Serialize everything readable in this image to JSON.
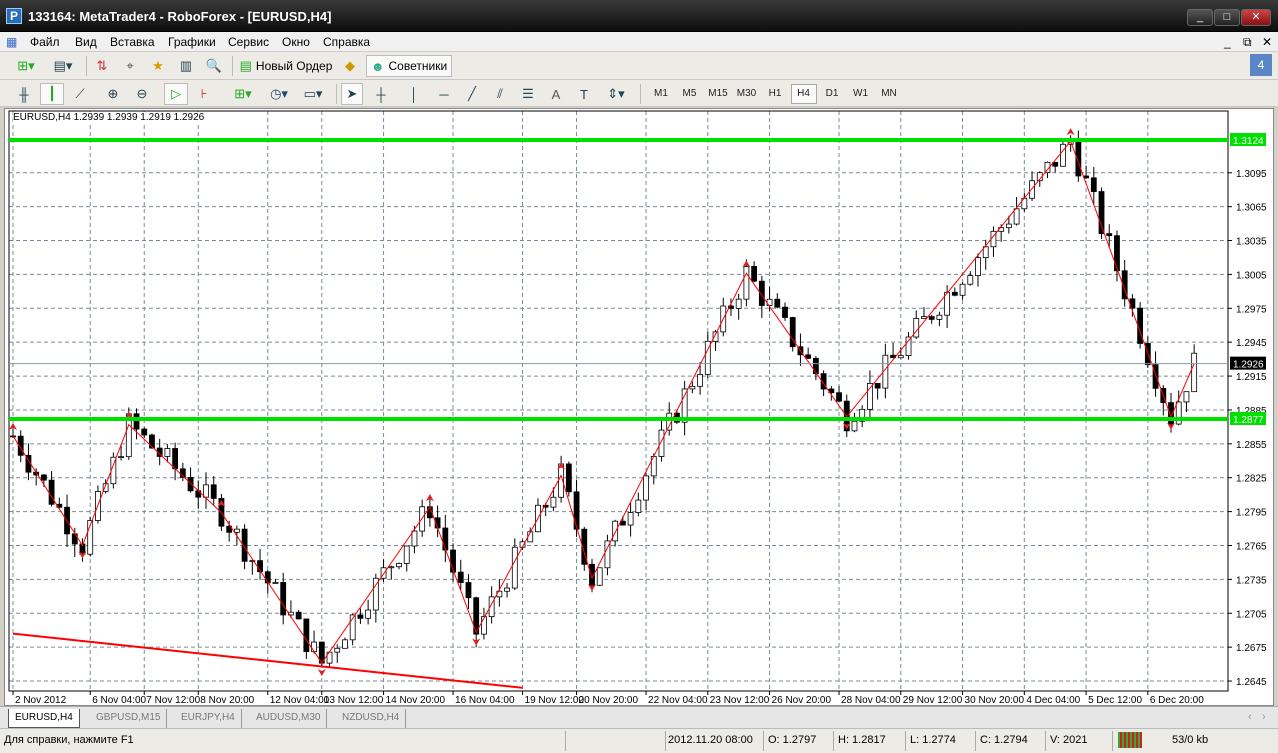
{
  "window": {
    "title": "133164: MetaTrader4 - RoboForex - [EURUSD,H4]",
    "app_icon": "P"
  },
  "menu": [
    "Файл",
    "Вид",
    "Вставка",
    "Графики",
    "Сервис",
    "Окно",
    "Справка"
  ],
  "toolbar": {
    "new_order": "Новый Ордер",
    "experts": "Советники",
    "text_tool": "A"
  },
  "timeframes": [
    "M1",
    "M5",
    "M15",
    "M30",
    "H1",
    "H4",
    "D1",
    "W1",
    "MN"
  ],
  "active_timeframe": "H4",
  "chart": {
    "ohlc_label": "EURUSD,H4  1.2939 1.2939 1.2919 1.2926",
    "price_ticks": [
      "1.3095",
      "1.3065",
      "1.3035",
      "1.3005",
      "1.2975",
      "1.2945",
      "1.2915",
      "1.2885",
      "1.2855",
      "1.2825",
      "1.2795",
      "1.2765",
      "1.2735",
      "1.2705",
      "1.2675",
      "1.2645"
    ],
    "levels": [
      {
        "price": 1.3124,
        "label": "1.3124",
        "color": "#00e000"
      },
      {
        "price": 1.2877,
        "label": "1.2877",
        "color": "#00e000"
      }
    ],
    "current_price": {
      "price": 1.2926,
      "label": "1.2926"
    },
    "time_labels": [
      {
        "bar": 0,
        "label": "2 Nov 2012"
      },
      {
        "bar": 10,
        "label": "6 Nov 04:00"
      },
      {
        "bar": 17,
        "label": "7 Nov 12:00"
      },
      {
        "bar": 24,
        "label": "8 Nov 20:00"
      },
      {
        "bar": 33,
        "label": "12 Nov 04:00"
      },
      {
        "bar": 40,
        "label": "13 Nov 12:00"
      },
      {
        "bar": 48,
        "label": "14 Nov 20:00"
      },
      {
        "bar": 57,
        "label": "16 Nov 04:00"
      },
      {
        "bar": 66,
        "label": "19 Nov 12:00"
      },
      {
        "bar": 73,
        "label": "20 Nov 20:00"
      },
      {
        "bar": 82,
        "label": "22 Nov 04:00"
      },
      {
        "bar": 90,
        "label": "23 Nov 12:00"
      },
      {
        "bar": 98,
        "label": "26 Nov 20:00"
      },
      {
        "bar": 107,
        "label": "28 Nov 04:00"
      },
      {
        "bar": 115,
        "label": "29 Nov 12:00"
      },
      {
        "bar": 123,
        "label": "30 Nov 20:00"
      },
      {
        "bar": 131,
        "label": "4 Dec 04:00"
      },
      {
        "bar": 139,
        "label": "5 Dec 12:00"
      },
      {
        "bar": 147,
        "label": "6 Dec 20:00"
      }
    ],
    "zigzag": [
      [
        0,
        1.2862
      ],
      [
        9,
        1.2765
      ],
      [
        15,
        1.2872
      ],
      [
        27,
        1.2794
      ],
      [
        40,
        1.2661
      ],
      [
        54,
        1.2799
      ],
      [
        60,
        1.2688
      ],
      [
        71,
        1.2827
      ],
      [
        75,
        1.2736
      ],
      [
        95,
        1.3006
      ],
      [
        108,
        1.2879
      ],
      [
        137,
        1.3123
      ],
      [
        150,
        1.2879
      ],
      [
        153,
        1.2926
      ]
    ],
    "trendline": [
      [
        0,
        1.2687
      ],
      [
        66,
        1.2639
      ]
    ],
    "colors": {
      "zigzag": "#ff0000",
      "trend": "#ff0000",
      "grid": "#7a8a9a",
      "level": "#00e000"
    }
  },
  "tabs": [
    "EURUSD,H4",
    "GBPUSD,M15",
    "EURJPY,H4",
    "AUDUSD,M30",
    "NZDUSD,H4"
  ],
  "status": {
    "help": "Для справки, нажмите F1",
    "datetime": "2012.11.20 08:00",
    "open": "O: 1.2797",
    "high": "H: 1.2817",
    "low": "L: 1.2774",
    "close": "C: 1.2794",
    "volume": "V: 2021",
    "traffic": "53/0 kb"
  }
}
